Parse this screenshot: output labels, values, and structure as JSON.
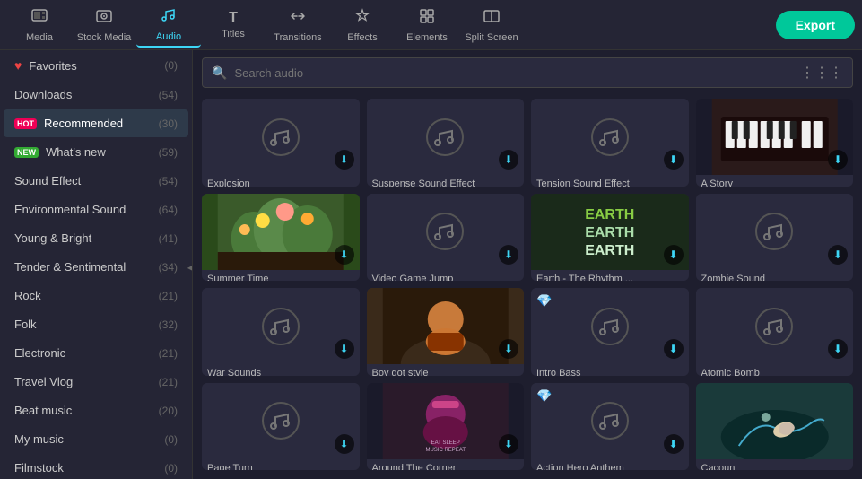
{
  "toolbar": {
    "items": [
      {
        "id": "media",
        "label": "Media",
        "icon": "🖥"
      },
      {
        "id": "stock-media",
        "label": "Stock Media",
        "icon": "🎬"
      },
      {
        "id": "audio",
        "label": "Audio",
        "icon": "🎵"
      },
      {
        "id": "titles",
        "label": "Titles",
        "icon": "T"
      },
      {
        "id": "transitions",
        "label": "Transitions",
        "icon": "⇄"
      },
      {
        "id": "effects",
        "label": "Effects",
        "icon": "✦"
      },
      {
        "id": "elements",
        "label": "Elements",
        "icon": "⬜"
      },
      {
        "id": "split-screen",
        "label": "Split Screen",
        "icon": "⊞"
      }
    ],
    "active": "audio",
    "export_label": "Export"
  },
  "sidebar": {
    "items": [
      {
        "id": "favorites",
        "label": "Favorites",
        "count": "(0)",
        "badge": null,
        "icon": "heart"
      },
      {
        "id": "downloads",
        "label": "Downloads",
        "count": "(54)",
        "badge": null
      },
      {
        "id": "recommended",
        "label": "Recommended",
        "count": "(30)",
        "badge": "HOT"
      },
      {
        "id": "whats-new",
        "label": "What's new",
        "count": "(59)",
        "badge": "NEW"
      },
      {
        "id": "sound-effect",
        "label": "Sound Effect",
        "count": "(54)",
        "badge": null
      },
      {
        "id": "environmental-sound",
        "label": "Environmental Sound",
        "count": "(64)",
        "badge": null
      },
      {
        "id": "young-bright",
        "label": "Young & Bright",
        "count": "(41)",
        "badge": null
      },
      {
        "id": "tender-sentimental",
        "label": "Tender & Sentimental",
        "count": "(34)",
        "badge": null,
        "collapse": true
      },
      {
        "id": "rock",
        "label": "Rock",
        "count": "(21)",
        "badge": null
      },
      {
        "id": "folk",
        "label": "Folk",
        "count": "(32)",
        "badge": null
      },
      {
        "id": "electronic",
        "label": "Electronic",
        "count": "(21)",
        "badge": null
      },
      {
        "id": "travel-vlog",
        "label": "Travel Vlog",
        "count": "(21)",
        "badge": null
      },
      {
        "id": "beat-music",
        "label": "Beat music",
        "count": "(20)",
        "badge": null
      },
      {
        "id": "my-music",
        "label": "My music",
        "count": "(0)",
        "badge": null
      },
      {
        "id": "filmstock",
        "label": "Filmstock",
        "count": "(0)",
        "badge": null
      }
    ]
  },
  "search": {
    "placeholder": "Search audio"
  },
  "audio_cards": [
    {
      "id": "explosion",
      "label": "Explosion",
      "has_image": false,
      "has_download": true,
      "premium": false
    },
    {
      "id": "suspense-sound-effect",
      "label": "Suspense Sound Effect",
      "has_image": false,
      "has_download": true,
      "premium": false
    },
    {
      "id": "tension-sound-effect",
      "label": "Tension Sound Effect",
      "has_image": false,
      "has_download": true,
      "premium": false
    },
    {
      "id": "a-story",
      "label": "A Story",
      "has_image": true,
      "image_bg": "piano",
      "has_download": true,
      "premium": false
    },
    {
      "id": "summer-time",
      "label": "Summer Time",
      "has_image": true,
      "image_bg": "flowers",
      "has_download": true,
      "premium": false
    },
    {
      "id": "video-game-jump",
      "label": "Video Game Jump",
      "has_image": false,
      "has_download": true,
      "premium": false
    },
    {
      "id": "earth-rhythm",
      "label": "Earth - The Rhythm ...",
      "has_image": true,
      "image_bg": "earth",
      "has_download": true,
      "premium": false
    },
    {
      "id": "zombie-sound",
      "label": "Zombie Sound",
      "has_image": false,
      "has_download": true,
      "premium": false
    },
    {
      "id": "war-sounds",
      "label": "War Sounds",
      "has_image": false,
      "has_download": true,
      "premium": false
    },
    {
      "id": "boy-got-style",
      "label": "Boy got style",
      "has_image": true,
      "image_bg": "style",
      "has_download": true,
      "premium": false
    },
    {
      "id": "intro-bass",
      "label": "Intro Bass",
      "has_image": false,
      "has_download": true,
      "premium": true
    },
    {
      "id": "atomic-bomb",
      "label": "Atomic Bomb",
      "has_image": false,
      "has_download": true,
      "premium": false
    },
    {
      "id": "page-turn",
      "label": "Page Turn",
      "has_image": false,
      "has_download": true,
      "premium": false
    },
    {
      "id": "around-the-corner",
      "label": "Around The Corner",
      "has_image": true,
      "image_bg": "corner",
      "has_download": true,
      "premium": false
    },
    {
      "id": "action-hero-anthem",
      "label": "Action Hero Anthem",
      "has_image": false,
      "has_download": true,
      "premium": true
    },
    {
      "id": "cacoun",
      "label": "Cacoun",
      "has_image": true,
      "image_bg": "hand",
      "has_download": false,
      "premium": false
    }
  ]
}
